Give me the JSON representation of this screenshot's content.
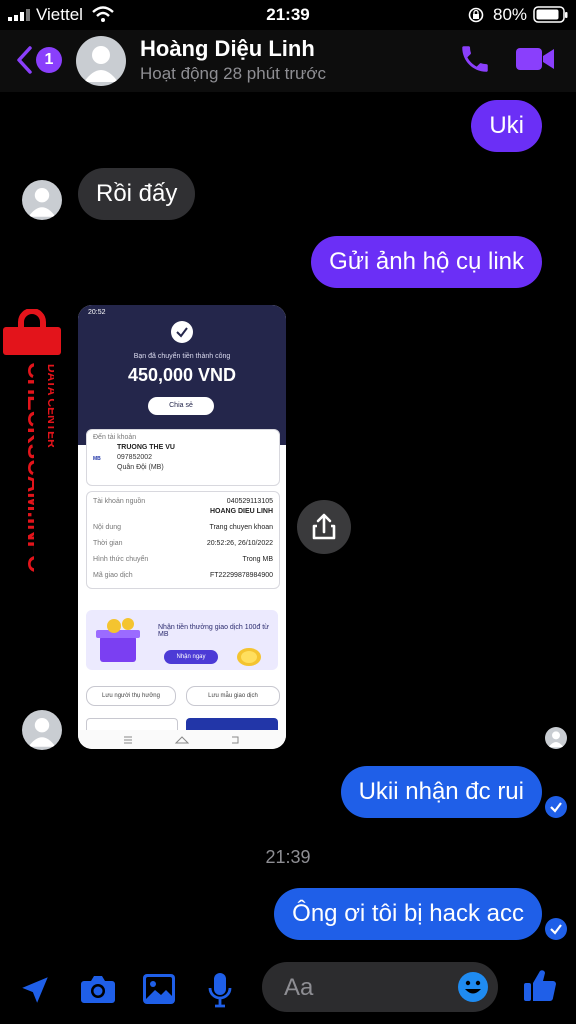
{
  "status_bar": {
    "carrier": "Viettel",
    "time": "21:39",
    "battery": "80%"
  },
  "header": {
    "back_badge": "1",
    "contact_name": "Hoàng Diệu Linh",
    "activity": "Hoạt động 28 phút trước"
  },
  "messages": [
    {
      "side": "out",
      "text": "Uki"
    },
    {
      "side": "in",
      "text": "Rồi đấy"
    },
    {
      "side": "out",
      "text": "Gửi ảnh hộ cụ link"
    },
    {
      "side": "out",
      "text": "Ukii nhận đc rui"
    },
    {
      "side": "out",
      "text": "Ông ơi tôi bị hack acc"
    }
  ],
  "timestamp": "21:39",
  "receipt_image": {
    "status_time": "20:52",
    "success_text": "Bạn đã chuyển tiền thành công",
    "amount": "450,000 VND",
    "share_label": "Chia sẻ",
    "to_label": "Đến tài khoản",
    "recipient_name": "TRUONG THE VU",
    "recipient_account": "097852002",
    "recipient_bank": "Quân Đội (MB)",
    "bank_logo": "MB",
    "details": [
      {
        "label": "Tài khoản nguồn",
        "value": "040529113105",
        "value2": "HOANG DIEU LINH"
      },
      {
        "label": "Nội dung",
        "value": "Trang chuyen khoan"
      },
      {
        "label": "Thời gian",
        "value": "20:52:26, 26/10/2022"
      },
      {
        "label": "Hình thức chuyển",
        "value": "Trong MB"
      },
      {
        "label": "Mã giao dịch",
        "value": "FT22299878984900"
      }
    ],
    "promo_text": "Nhận tiền thưởng giao dịch 100đ từ MB",
    "promo_button": "Nhận ngay",
    "save_recipient": "Lưu người thụ hưởng",
    "save_template": "Lưu mẫu giao dịch"
  },
  "watermark": {
    "main": "CHECKSCAM.INFO",
    "sub": "DATA CENTER",
    "color": "#e3141b"
  },
  "composer": {
    "placeholder": "Aa"
  },
  "colors": {
    "accent": "#8a3ffc",
    "outgoing": "#6b2ff6",
    "outgoing_blue": "#1f5fe8",
    "incoming": "#303033"
  }
}
